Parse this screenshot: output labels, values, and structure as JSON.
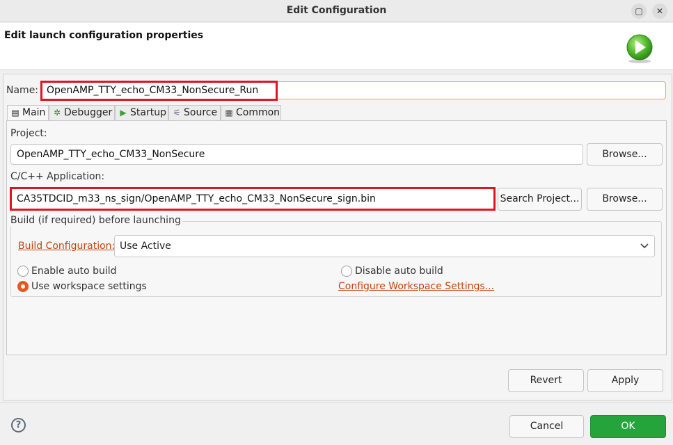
{
  "window": {
    "title": "Edit Configuration",
    "maximize_glyph": "▢",
    "close_glyph": "✕"
  },
  "header": {
    "title": "Edit launch configuration properties",
    "icon": "run-icon"
  },
  "name_field": {
    "label": "Name:",
    "value": "OpenAMP_TTY_echo_CM33_NonSecure_Run"
  },
  "tabs": [
    {
      "label": "Main",
      "icon": "page-icon",
      "glyph": "▤",
      "active": true
    },
    {
      "label": "Debugger",
      "icon": "bug-icon",
      "glyph": "✲",
      "active": false
    },
    {
      "label": "Startup",
      "icon": "play-icon",
      "glyph": "▶",
      "active": false
    },
    {
      "label": "Source",
      "icon": "source-icon",
      "glyph": "⚟",
      "active": false
    },
    {
      "label": "Common",
      "icon": "common-icon",
      "glyph": "▦",
      "active": false
    }
  ],
  "main": {
    "project_label": "Project:",
    "project_value": "OpenAMP_TTY_echo_CM33_NonSecure",
    "browse_label": "Browse...",
    "app_label": "C/C++ Application:",
    "app_value": "CA35TDCID_m33_ns_sign/OpenAMP_TTY_echo_CM33_NonSecure_sign.bin",
    "search_project_label": "Search Project...",
    "browse2_label": "Browse...",
    "build": {
      "group_title": "Build (if required) before launching",
      "config_link": "Build Configuration:",
      "config_value": "Use Active",
      "enable_auto_build": "Enable auto build",
      "disable_auto_build": "Disable auto build",
      "use_workspace": "Use workspace settings",
      "configure_link": "Configure Workspace Settings..."
    }
  },
  "actions": {
    "revert": "Revert",
    "apply": "Apply"
  },
  "footer": {
    "help_glyph": "?",
    "cancel": "Cancel",
    "ok": "OK"
  },
  "colors": {
    "accent": "#e95420",
    "highlight": "#e0141e",
    "ok": "#26a43c",
    "link": "#c1440e"
  }
}
